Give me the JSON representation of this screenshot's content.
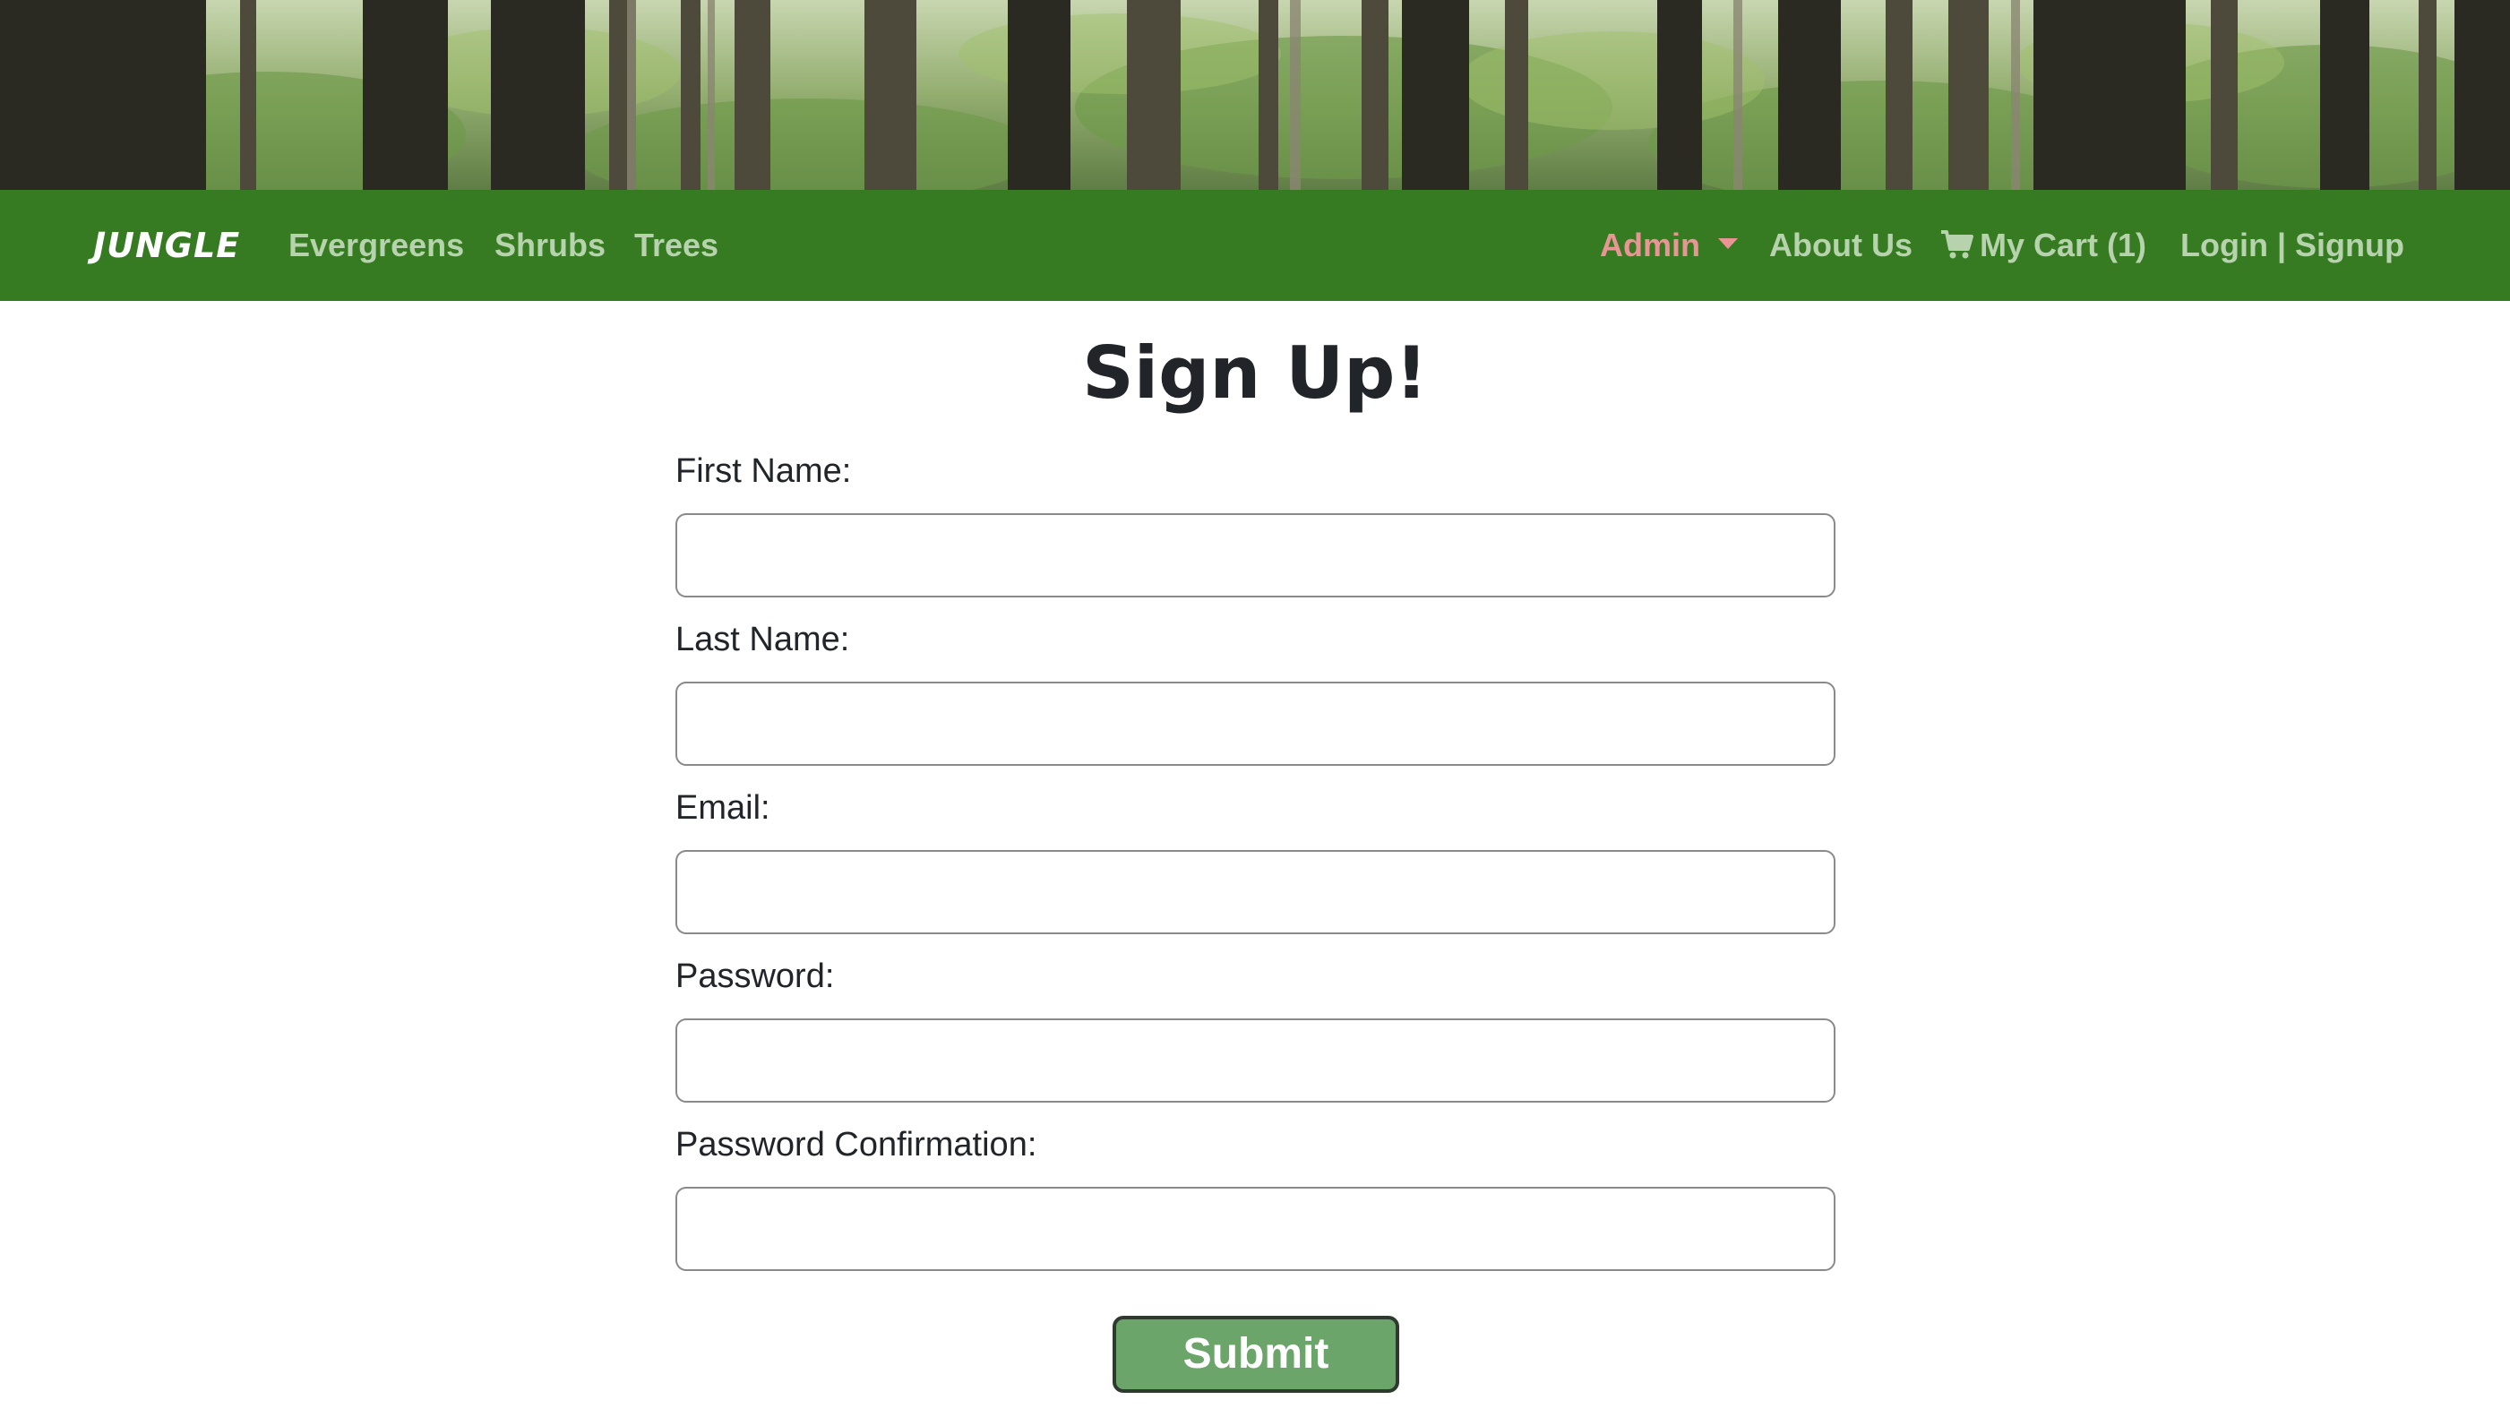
{
  "nav": {
    "brand": "JUNGLE",
    "links": [
      "Evergreens",
      "Shrubs",
      "Trees"
    ],
    "admin_label": "Admin",
    "about_label": "About Us",
    "cart_label": "My Cart (1)",
    "auth_label": "Login | Signup"
  },
  "form": {
    "title": "Sign Up!",
    "fields": [
      {
        "label": "First Name:",
        "value": ""
      },
      {
        "label": "Last Name:",
        "value": ""
      },
      {
        "label": "Email:",
        "value": ""
      },
      {
        "label": "Password:",
        "value": ""
      },
      {
        "label": "Password Confirmation:",
        "value": ""
      }
    ],
    "submit_label": "Submit"
  },
  "colors": {
    "navbar": "#367b22",
    "nav_link": "#b7d3ad",
    "admin_link": "#e99595",
    "submit": "#6ba56a"
  },
  "icons": {
    "cart": "cart-icon",
    "caret": "caret-down-icon"
  }
}
